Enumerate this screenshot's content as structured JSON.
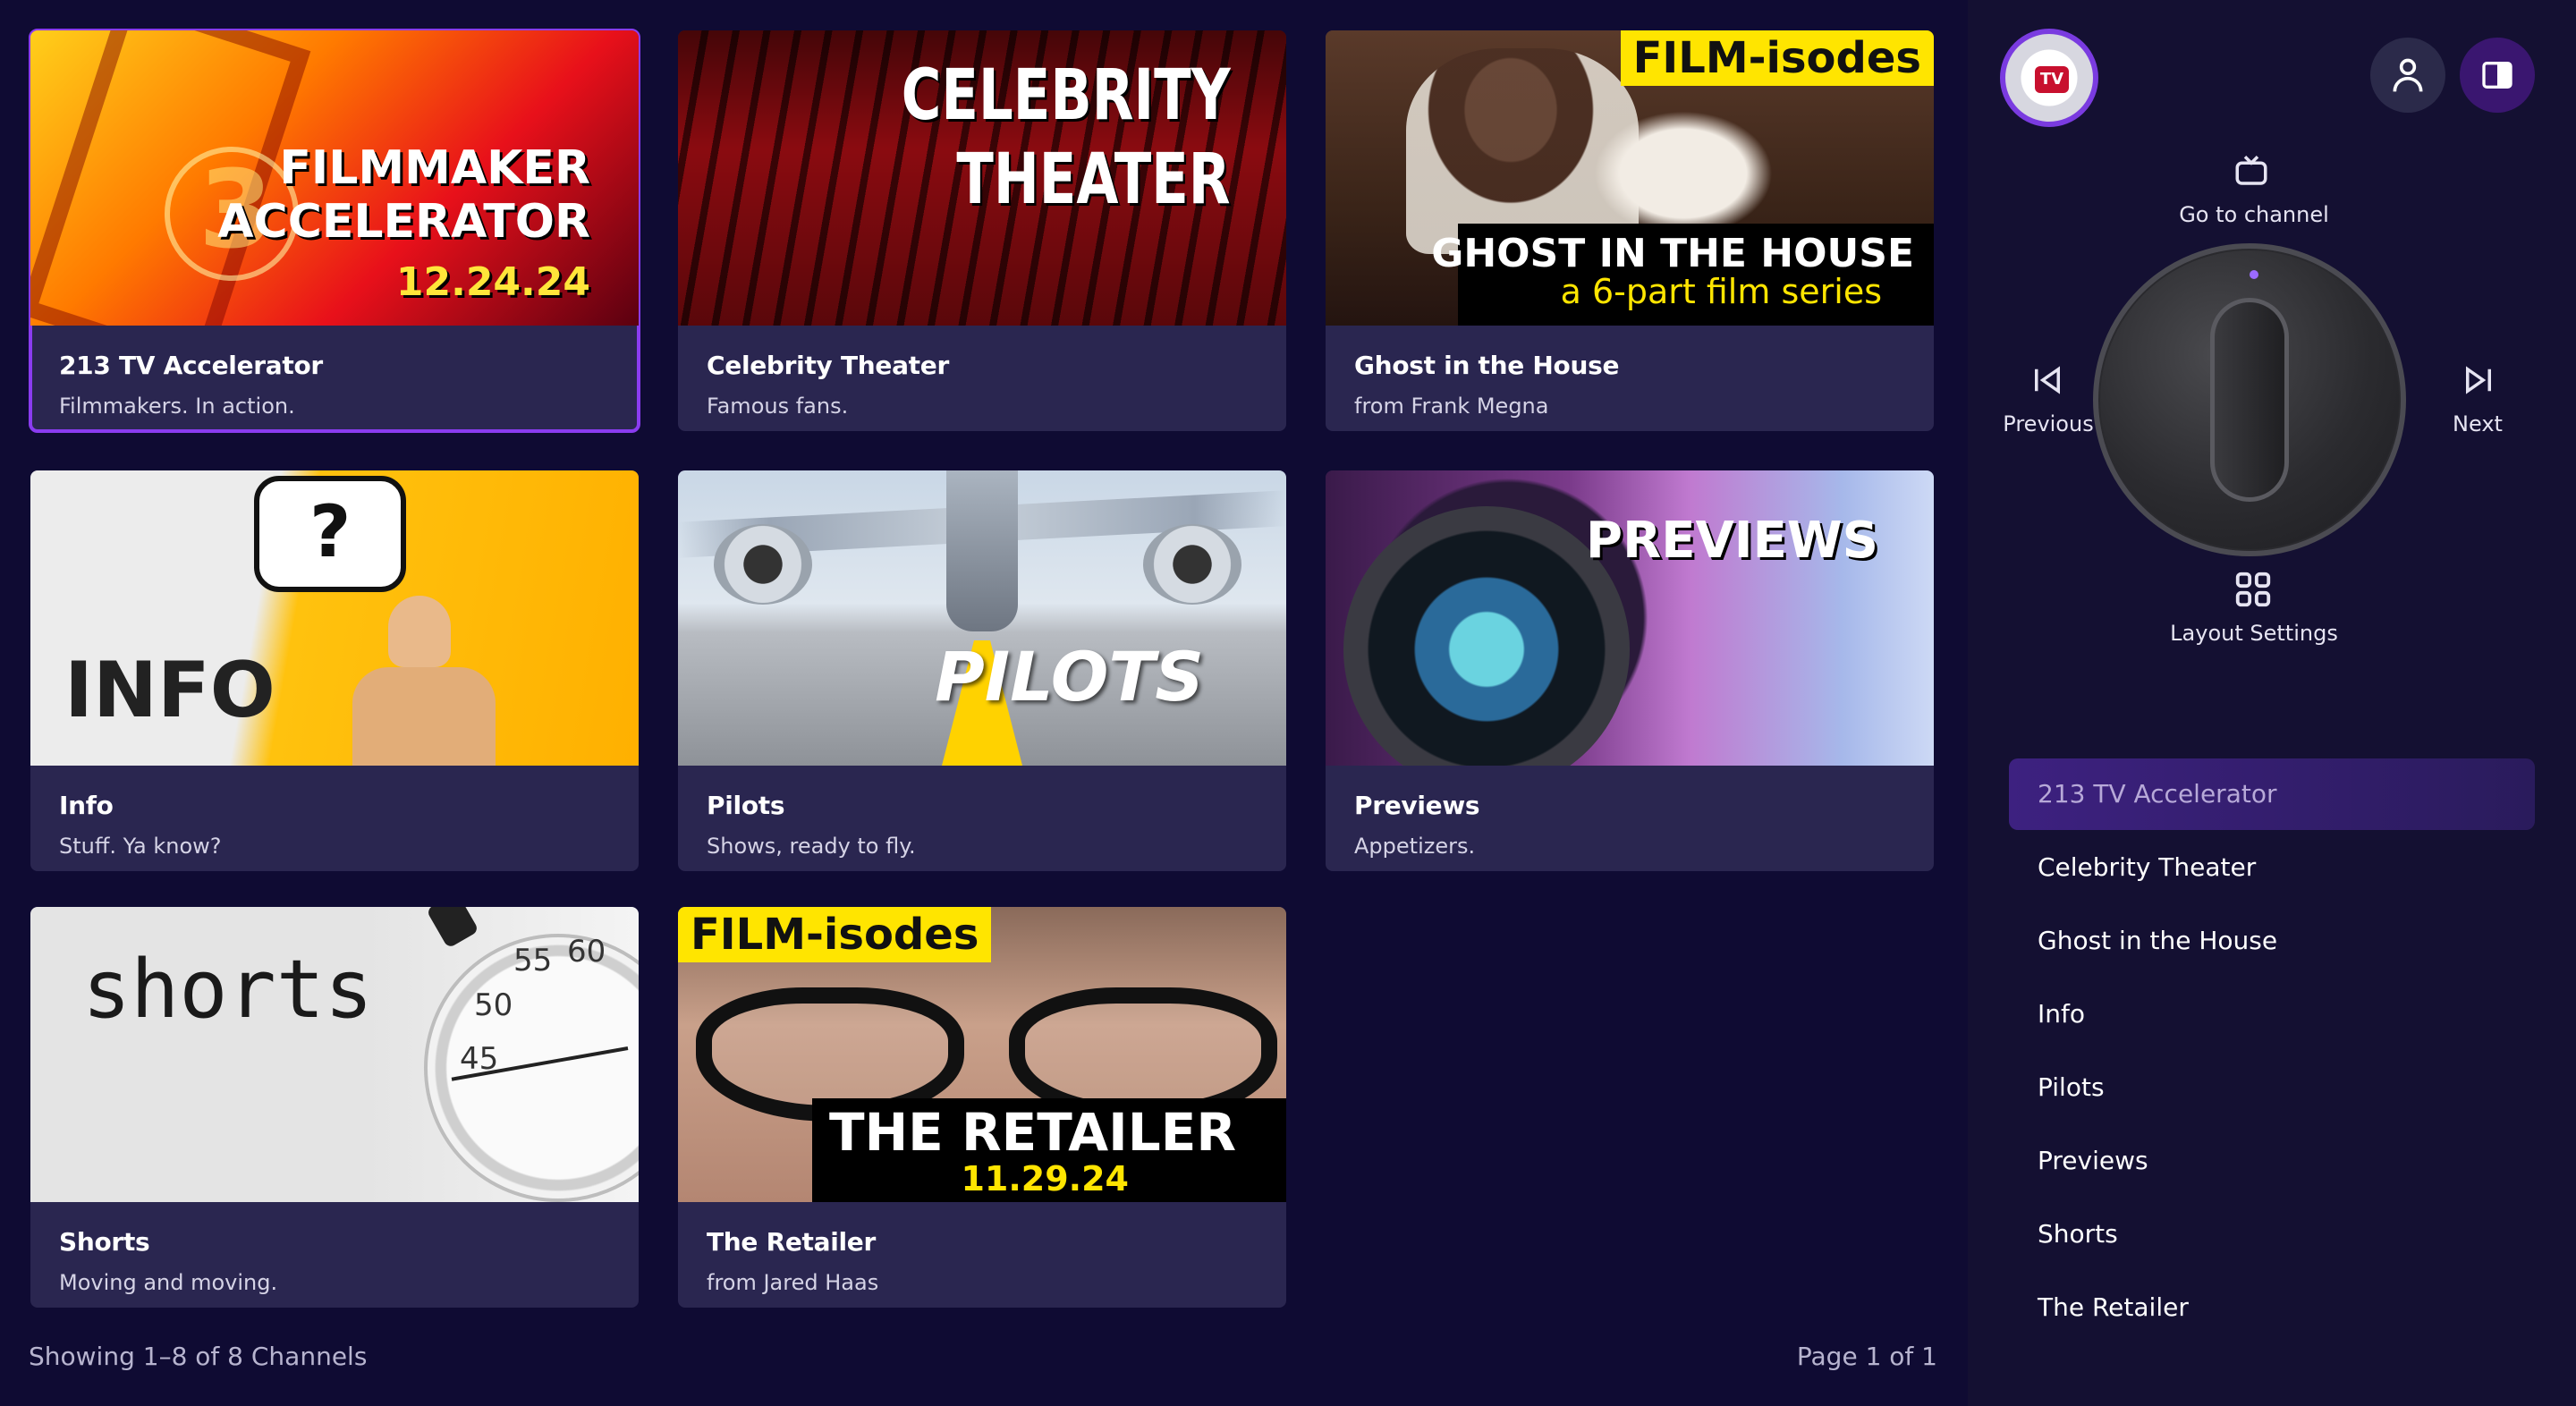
{
  "cards": [
    {
      "title": "213 TV Accelerator",
      "subtitle": "Filmmakers. In action.",
      "art": [
        "FILMMAKER",
        "ACCELERATOR",
        "12.24.24",
        "3"
      ]
    },
    {
      "title": "Celebrity Theater",
      "subtitle": "Famous fans.",
      "art": [
        "CELEBRITY",
        "THEATER"
      ]
    },
    {
      "title": "Ghost in the House",
      "subtitle": "from Frank Megna",
      "art": [
        "FILM-isodes",
        "GHOST IN THE HOUSE",
        "a 6-part film series"
      ]
    },
    {
      "title": "Info",
      "subtitle": "Stuff. Ya know?",
      "art": [
        "INFO",
        "?"
      ]
    },
    {
      "title": "Pilots",
      "subtitle": "Shows, ready to fly.",
      "art": [
        "PILOTS"
      ]
    },
    {
      "title": "Previews",
      "subtitle": "Appetizers.",
      "art": [
        "PREVIEWS"
      ]
    },
    {
      "title": "Shorts",
      "subtitle": "Moving and moving.",
      "art": [
        "shorts",
        "55",
        "60",
        "50",
        "45"
      ]
    },
    {
      "title": "The Retailer",
      "subtitle": " from Jared Haas",
      "art": [
        "FILM-isodes",
        "THE RETAILER",
        "11.29.24"
      ]
    }
  ],
  "footer": {
    "showing": "Showing 1–8 of 8 Channels",
    "page": "Page 1 of 1"
  },
  "logo": {
    "text": "TV"
  },
  "remote": {
    "go_to_channel": "Go to channel",
    "previous": "Previous",
    "next": "Next",
    "layout_settings": "Layout Settings"
  },
  "channel_list": [
    "213 TV Accelerator",
    "Celebrity Theater",
    "Ghost in the House",
    "Info",
    "Pilots",
    "Previews",
    "Shorts",
    "The Retailer"
  ],
  "colors": {
    "background": "#0f0b33",
    "card": "#2a2650",
    "accent": "#8a3cf0",
    "sidebar": "#141032"
  }
}
